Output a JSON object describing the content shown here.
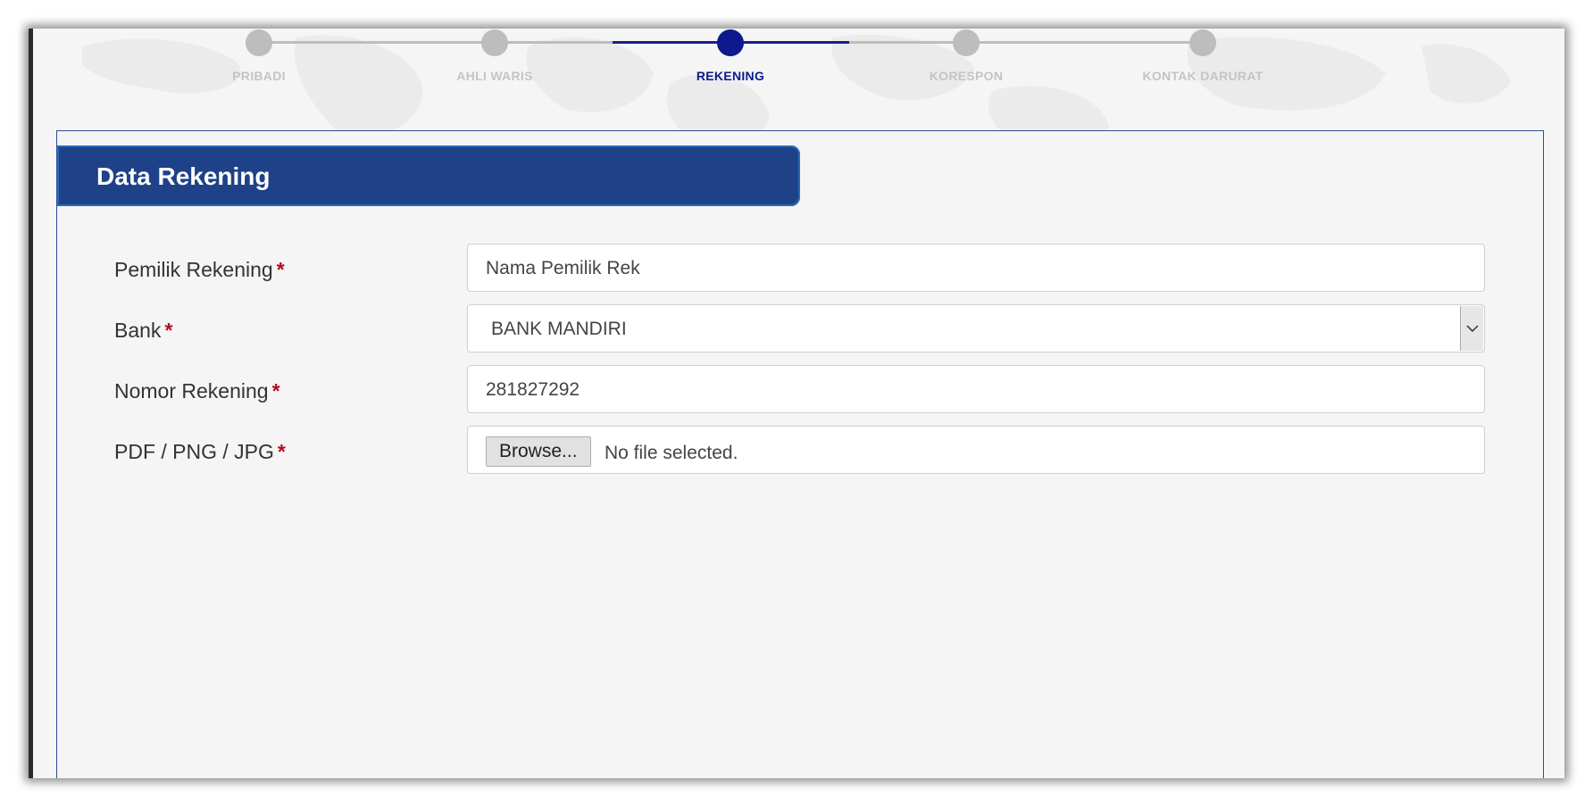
{
  "stepper": {
    "steps": [
      {
        "label": "PRIBADI",
        "active": false
      },
      {
        "label": "AHLI WARIS",
        "active": false
      },
      {
        "label": "REKENING",
        "active": true
      },
      {
        "label": "KORESPON",
        "active": false
      },
      {
        "label": "KONTAK DARURAT",
        "active": false
      }
    ]
  },
  "panel": {
    "title": "Data Rekening"
  },
  "form": {
    "required_mark": "*",
    "owner": {
      "label": "Pemilik Rekening",
      "value": "Nama Pemilik Rek"
    },
    "bank": {
      "label": "Bank",
      "value": "BANK MANDIRI"
    },
    "account_number": {
      "label": "Nomor Rekening",
      "value": "281827292"
    },
    "file": {
      "label": "PDF / PNG / JPG",
      "button": "Browse...",
      "status": "No file selected."
    }
  },
  "colors": {
    "header_blue": "#1f4188",
    "active_step": "#0d1a8e",
    "inactive_step": "#bdbdbd",
    "required": "#b10d1c"
  },
  "icons": {
    "select_arrow": "chevron-down-icon"
  }
}
